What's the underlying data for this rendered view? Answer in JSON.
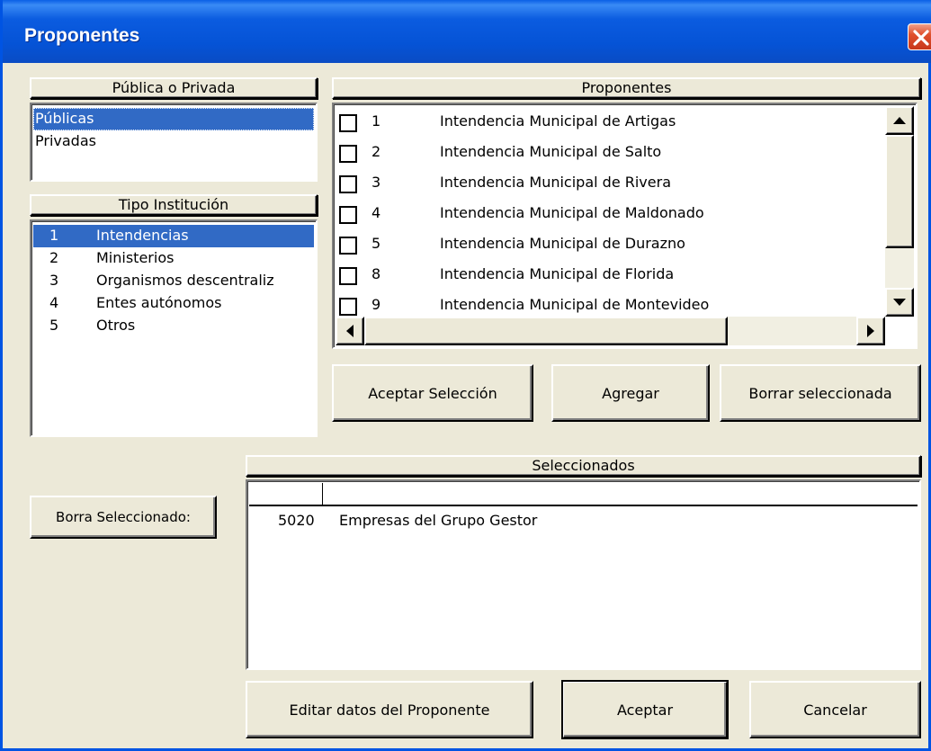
{
  "window": {
    "title": "Proponentes"
  },
  "publica_privada": {
    "header": "Pública o Privada",
    "items": [
      {
        "label": "Públicas",
        "selected": true
      },
      {
        "label": "Privadas",
        "selected": false
      }
    ]
  },
  "tipo_institucion": {
    "header": "Tipo Institución",
    "items": [
      {
        "num": "1",
        "label": "Intendencias",
        "selected": true
      },
      {
        "num": "2",
        "label": "Ministerios",
        "selected": false
      },
      {
        "num": "3",
        "label": "Organismos descentraliz",
        "selected": false
      },
      {
        "num": "4",
        "label": "Entes autónomos",
        "selected": false
      },
      {
        "num": "5",
        "label": "Otros",
        "selected": false
      }
    ]
  },
  "proponentes": {
    "header": "Proponentes",
    "rows": [
      {
        "num": "1",
        "name": "Intendencia Municipal de Artigas",
        "checked": false
      },
      {
        "num": "2",
        "name": "Intendencia Municipal de Salto",
        "checked": false
      },
      {
        "num": "3",
        "name": "Intendencia Municipal de Rivera",
        "checked": false
      },
      {
        "num": "4",
        "name": "Intendencia Municipal de Maldonado",
        "checked": false
      },
      {
        "num": "5",
        "name": "Intendencia Municipal de Durazno",
        "checked": false
      },
      {
        "num": "8",
        "name": "Intendencia Municipal de Florida",
        "checked": false
      },
      {
        "num": "9",
        "name": "Intendencia Municipal de  Montevideo",
        "checked": false
      }
    ]
  },
  "actions": {
    "aceptar_seleccion": "Aceptar Selección",
    "agregar": "Agregar",
    "borrar_seleccionada": "Borrar seleccionada",
    "borra_seleccionado": "Borra Seleccionado:",
    "editar_datos": "Editar datos del Proponente",
    "aceptar": "Aceptar",
    "cancelar": "Cancelar"
  },
  "seleccionados": {
    "header": "Seleccionados",
    "rows": [
      {
        "code": "5020",
        "name": "Empresas del Grupo Gestor"
      }
    ]
  },
  "colors": {
    "titlebar": "#0553d6",
    "selection": "#316ac5",
    "dialog_bg": "#ece9d8",
    "close_button": "#e0512e"
  },
  "icons": {
    "close": "close-icon",
    "scroll_up": "arrow-up-icon",
    "scroll_down": "arrow-down-icon",
    "scroll_left": "arrow-left-icon",
    "scroll_right": "arrow-right-icon"
  }
}
